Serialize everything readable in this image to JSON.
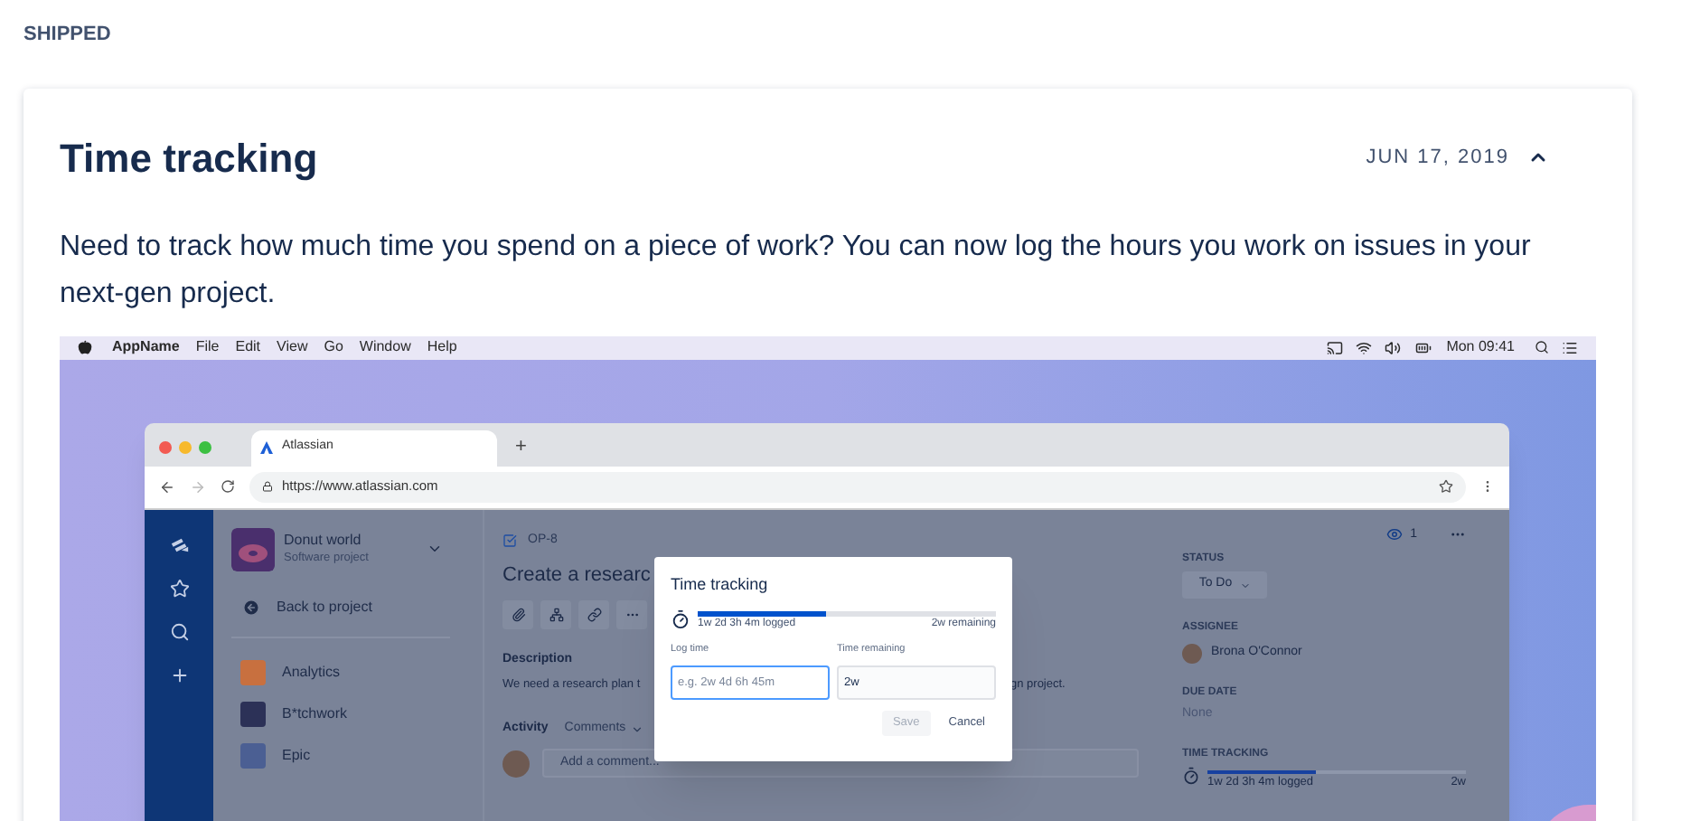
{
  "section_label": "SHIPPED",
  "entry": {
    "title": "Time tracking",
    "date": "JUN 17, 2019",
    "expanded": true,
    "description": "Need to track how much time you spend on a piece of work? You can now log the hours you work on issues in your next-gen project."
  },
  "screenshot": {
    "menubar": {
      "app_name": "AppName",
      "menus": [
        "File",
        "Edit",
        "View",
        "Go",
        "Window",
        "Help"
      ],
      "clock": "Mon 09:41"
    },
    "browser": {
      "tabs": [
        {
          "title": "Atlassian",
          "selected": true
        }
      ],
      "new_tab": "+",
      "url": "https://www.atlassian.com"
    },
    "project": {
      "name": "Donut world",
      "type": "Software project",
      "back": "Back to project",
      "items": [
        {
          "label": "Analytics",
          "color": "#c8703f"
        },
        {
          "label": "B*tchwork",
          "color": "#2c3157"
        },
        {
          "label": "Epic",
          "color": "#4b5f93"
        }
      ]
    },
    "issue": {
      "key": "OP-8",
      "title": "Create a researc",
      "description_label": "Description",
      "description_start": "We need a research plan t",
      "description_end": "gn project.",
      "activity_label": "Activity",
      "activity_filter": "Comments",
      "comment_placeholder": "Add a comment..."
    },
    "details": {
      "watchers": "1",
      "status_label": "STATUS",
      "status": "To Do",
      "assignee_label": "ASSIGNEE",
      "assignee": "Brona O'Connor",
      "due_label": "DUE DATE",
      "due": "None",
      "tracking_label": "TIME TRACKING",
      "logged": "1w 2d 3h 4m logged",
      "remaining": "2w",
      "level": 0.42
    },
    "dialog": {
      "title": "Time tracking",
      "level": 0.43,
      "logged": "1w 2d 3h 4m logged",
      "remaining": "2w remaining",
      "fields": [
        {
          "label": "Log time",
          "placeholder": "e.g. 2w 4d 6h 45m",
          "focused": true
        },
        {
          "label": "Time remaining",
          "value": "2w",
          "focused": false
        }
      ],
      "buttons": [
        {
          "label": "Save",
          "disabled": true
        },
        {
          "label": "Cancel",
          "disabled": false
        }
      ]
    }
  }
}
